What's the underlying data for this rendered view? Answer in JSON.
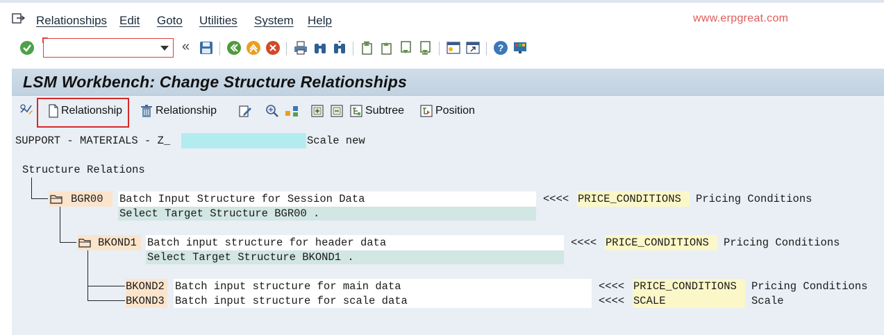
{
  "menu": {
    "items": [
      "Relationships",
      "Edit",
      "Goto",
      "Utilities",
      "System",
      "Help"
    ],
    "watermark": "www.erpgreat.com"
  },
  "toolbar": {
    "command_field_value": "",
    "back_glyph": "«",
    "icons": [
      "check-icon",
      "save-icon",
      "back-icon",
      "exit-icon",
      "cancel-icon",
      "print-icon",
      "find-icon",
      "find-next-icon",
      "first-page-icon",
      "previous-page-icon",
      "next-page-icon",
      "last-page-icon",
      "new-session-icon",
      "shortcut-icon",
      "help-icon",
      "layout-icon"
    ]
  },
  "title": "LSM Workbench: Change Structure Relationships",
  "app_toolbar": {
    "create_relationship": "Relationship",
    "delete_relationship": "Relationship",
    "subtree": "Subtree",
    "position": "Position"
  },
  "header_line": {
    "prefix": "SUPPORT - MATERIALS - Z_",
    "suffix": "Scale new"
  },
  "tree": {
    "root": "Structure Relations",
    "nodes": [
      {
        "code": "BGR00",
        "desc": "Batch Input Structure for Session Data",
        "arrow": "<<<<",
        "source": "PRICE_CONDITIONS",
        "source_desc": "Pricing Conditions",
        "sub": "Select Target Structure BGR00 ."
      },
      {
        "code": "BKOND1",
        "desc": "Batch input structure for header data",
        "arrow": "<<<<",
        "source": "PRICE_CONDITIONS",
        "source_desc": "Pricing Conditions",
        "sub": "Select Target Structure BKOND1 ."
      },
      {
        "code": "BKOND2",
        "desc": "Batch input structure for main data",
        "arrow": "<<<<",
        "source": "PRICE_CONDITIONS",
        "source_desc": "Pricing Conditions"
      },
      {
        "code": "BKOND3",
        "desc": "Batch input structure for scale data",
        "arrow": "<<<<",
        "source": "SCALE",
        "source_desc": "Scale"
      }
    ]
  },
  "colors": {
    "title_bar": "#c7d6e4",
    "content_bg": "#e9eff5",
    "highlight": "#d62828",
    "watermark": "#e05a5a"
  }
}
